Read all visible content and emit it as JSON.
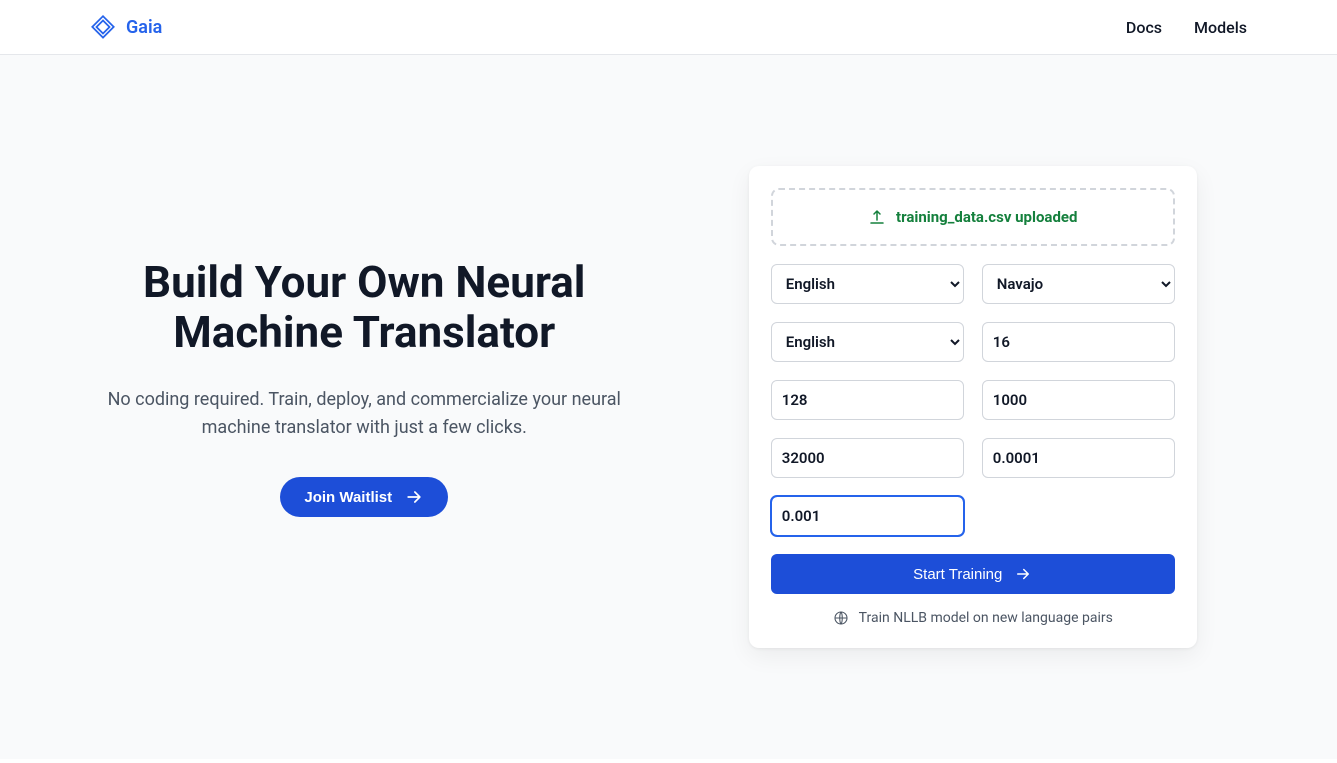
{
  "brand": "Gaia",
  "nav": {
    "docs": "Docs",
    "models": "Models"
  },
  "hero": {
    "title": "Build Your Own Neural Machine Translator",
    "subtitle": "No coding required. Train, deploy, and commercialize your neural machine translator with just a few clicks.",
    "cta": "Join Waitlist"
  },
  "form": {
    "upload_label": "training_data.csv uploaded",
    "source_lang": "English",
    "target_lang": "Navajo",
    "tokenizer_lang": "English",
    "batch_size": "16",
    "seq_len": "128",
    "epochs": "1000",
    "vocab_size": "32000",
    "weight_decay": "0.0001",
    "learning_rate": "0.001",
    "start_button": "Start Training",
    "note": "Train NLLB model on new language pairs"
  }
}
